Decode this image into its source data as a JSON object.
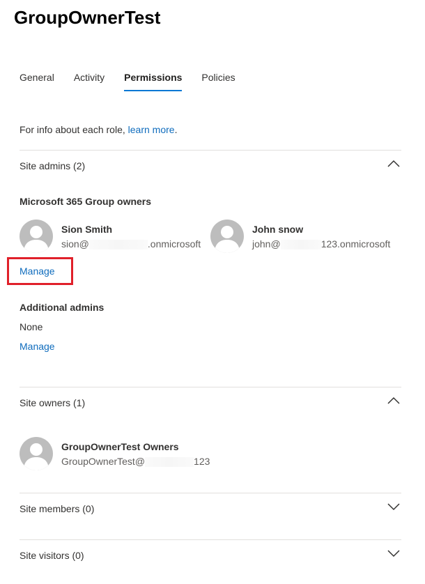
{
  "page": {
    "title": "GroupOwnerTest"
  },
  "tabs": [
    {
      "label": "General",
      "active": false
    },
    {
      "label": "Activity",
      "active": false
    },
    {
      "label": "Permissions",
      "active": true
    },
    {
      "label": "Policies",
      "active": false
    }
  ],
  "info": {
    "prefix": "For info about each role, ",
    "link": "learn more",
    "suffix": "."
  },
  "site_admins": {
    "header": "Site admins (2)",
    "expanded": true,
    "group_owners_label": "Microsoft 365 Group owners",
    "people": [
      {
        "name": "Sion Smith",
        "email_start": "sion@",
        "email_end": ".onmicrosoft"
      },
      {
        "name": "John snow",
        "email_start": "john@",
        "email_end": "123.onmicrosoft"
      }
    ],
    "manage_label": "Manage",
    "additional_label": "Additional admins",
    "additional_value": "None",
    "additional_manage_label": "Manage"
  },
  "site_owners": {
    "header": "Site owners (1)",
    "expanded": true,
    "people": [
      {
        "name": "GroupOwnerTest Owners",
        "email_start": "GroupOwnerTest@",
        "email_end": "123"
      }
    ]
  },
  "site_members": {
    "header": "Site members (0)",
    "expanded": false
  },
  "site_visitors": {
    "header": "Site visitors (0)",
    "expanded": false
  },
  "colors": {
    "accent": "#0078d4",
    "link": "#0f6cbd",
    "highlight": "#e0202a"
  },
  "icons": {
    "expanded": "chevron-up-icon",
    "collapsed": "chevron-down-icon",
    "avatar": "person-icon"
  }
}
